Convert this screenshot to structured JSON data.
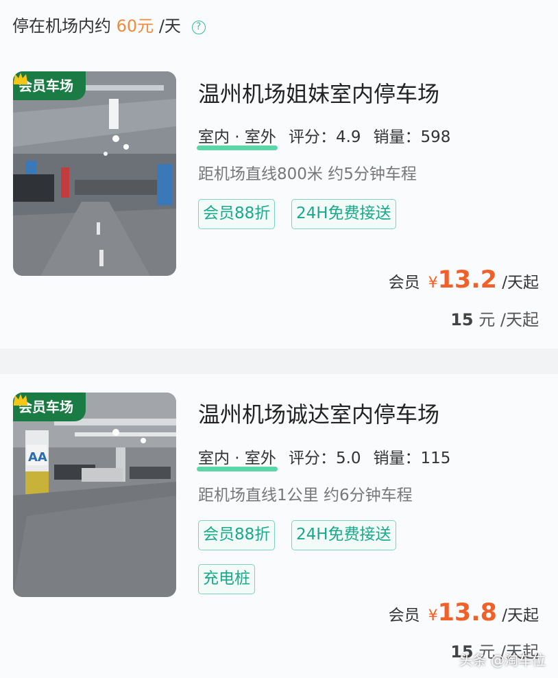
{
  "header": {
    "prefix": "停在机场内约",
    "price": "60元",
    "suffix": "/天",
    "help_glyph": "?"
  },
  "lots": [
    {
      "badge": "会员车场",
      "title": "温州机场姐妹室内停车场",
      "location_type": "室内 · 室外",
      "rating_label": "评分：4.9",
      "sales_label": "销量：598",
      "distance": "距机场直线800米 约5分钟车程",
      "tags": [
        "会员88折",
        "24H免费接送"
      ],
      "member_label": "会员",
      "currency": "¥",
      "member_price": "13.2",
      "price_unit": "/天起",
      "base_price": "15",
      "base_unit": "元 /天起"
    },
    {
      "badge": "会员车场",
      "title": "温州机场诚达室内停车场",
      "location_type": "室内 · 室外",
      "rating_label": "评分：5.0",
      "sales_label": "销量：115",
      "distance": "距机场直线1公里 约6分钟车程",
      "tags": [
        "会员88折",
        "24H免费接送",
        "充电桩"
      ],
      "member_label": "会员",
      "currency": "¥",
      "member_price": "13.8",
      "price_unit": "/天起",
      "base_price": "15",
      "base_unit": "元 /天起"
    }
  ],
  "watermark": "头条 @淘车位",
  "colors": {
    "accent": "#f2602a",
    "tag_green": "#1aa88a",
    "badge_green": "#1a7b45",
    "header_price": "#f08a3c"
  }
}
